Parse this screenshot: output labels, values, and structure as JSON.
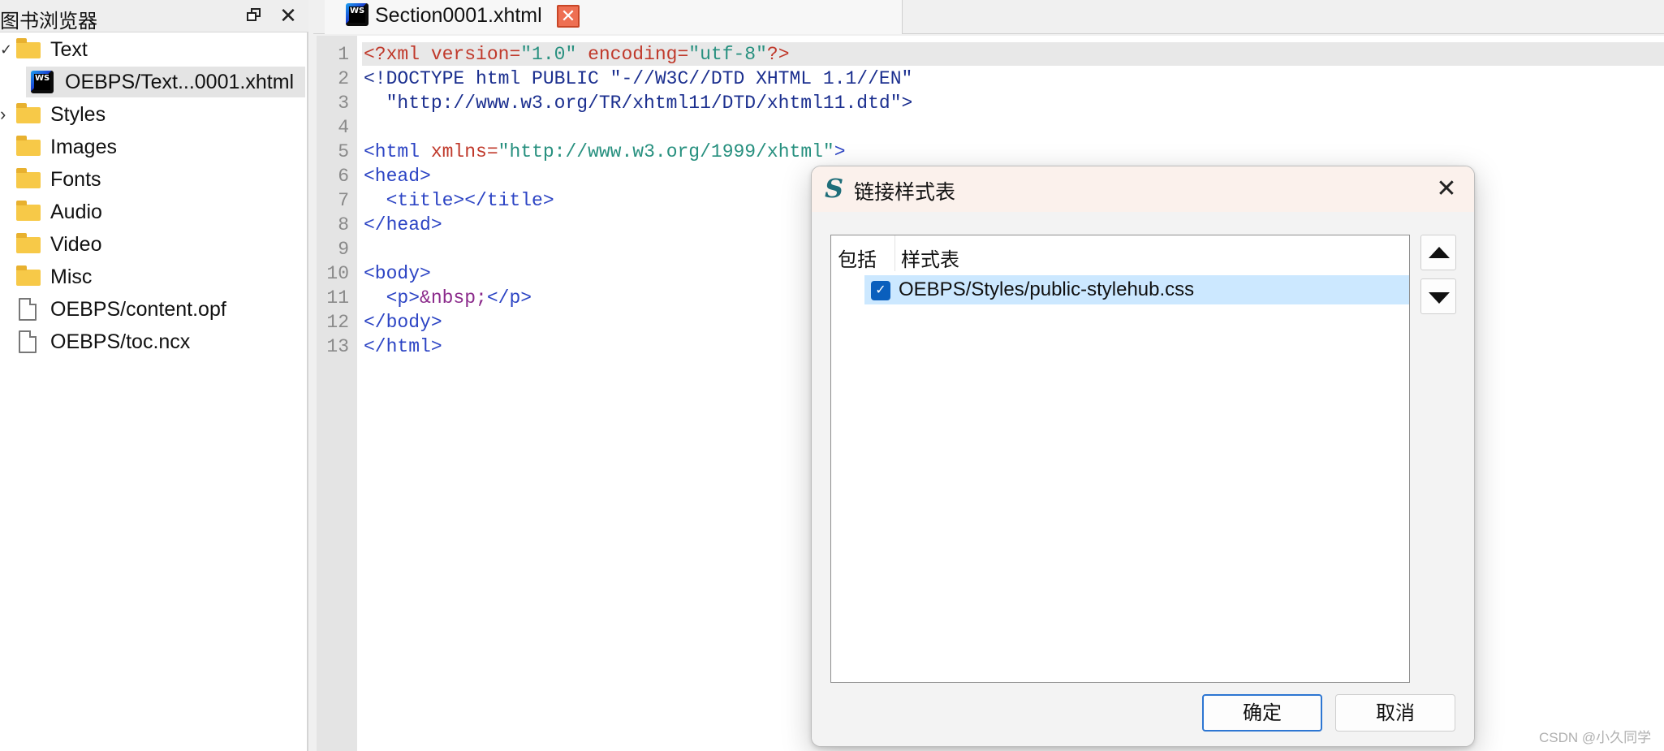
{
  "book_browser": {
    "title": "图书浏览器",
    "tree": [
      {
        "label": "Text",
        "type": "folder",
        "expanded": true
      },
      {
        "label": "OEBPS/Text...0001.xhtml",
        "type": "xhtml",
        "selected": true
      },
      {
        "label": "Styles",
        "type": "folder",
        "collapsed_arrow": true
      },
      {
        "label": "Images",
        "type": "folder"
      },
      {
        "label": "Fonts",
        "type": "folder"
      },
      {
        "label": "Audio",
        "type": "folder"
      },
      {
        "label": "Video",
        "type": "folder"
      },
      {
        "label": "Misc",
        "type": "folder"
      },
      {
        "label": "OEBPS/content.opf",
        "type": "file"
      },
      {
        "label": "OEBPS/toc.ncx",
        "type": "file"
      }
    ]
  },
  "tab": {
    "label": "Section0001.xhtml",
    "close_glyph": "✕"
  },
  "editor": {
    "line_numbers": [
      "1",
      "2",
      "3",
      "4",
      "5",
      "6",
      "7",
      "8",
      "9",
      "10",
      "11",
      "12",
      "13"
    ],
    "code": {
      "l1a": "<?xml ",
      "l1b": "version=",
      "l1c": "\"1.0\"",
      "l1d": " encoding=",
      "l1e": "\"utf-8\"",
      "l1f": "?>",
      "l2": "<!DOCTYPE html PUBLIC \"-//W3C//DTD XHTML 1.1//EN\"",
      "l3": "  \"http://www.w3.org/TR/xhtml11/DTD/xhtml11.dtd\">",
      "l5a": "<html ",
      "l5b": "xmlns=",
      "l5c": "\"http://www.w3.org/1999/xhtml\"",
      "l5d": ">",
      "l6": "<head>",
      "l7": "  <title></title>",
      "l8": "</head>",
      "l10": "<body>",
      "l11a": "  <p>",
      "l11b": "&nbsp;",
      "l11c": "</p>",
      "l12": "</body>",
      "l13": "</html>"
    }
  },
  "dialog": {
    "app_icon": "S",
    "title": "链接样式表",
    "close_glyph": "✕",
    "columns": {
      "include": "包括",
      "stylesheet": "样式表"
    },
    "rows": [
      {
        "checked": true,
        "check_glyph": "✓",
        "label": "OEBPS/Styles/public-stylehub.css"
      }
    ],
    "ok_label": "确定",
    "cancel_label": "取消"
  },
  "watermark": "CSDN @小久同学",
  "colors": {
    "tag": "#2c44c4",
    "attribute": "#c0392b",
    "value": "#27907f",
    "selection": "#cce8ff",
    "checkbox": "#0a5fbd",
    "tab_close": "#ee6f52"
  }
}
